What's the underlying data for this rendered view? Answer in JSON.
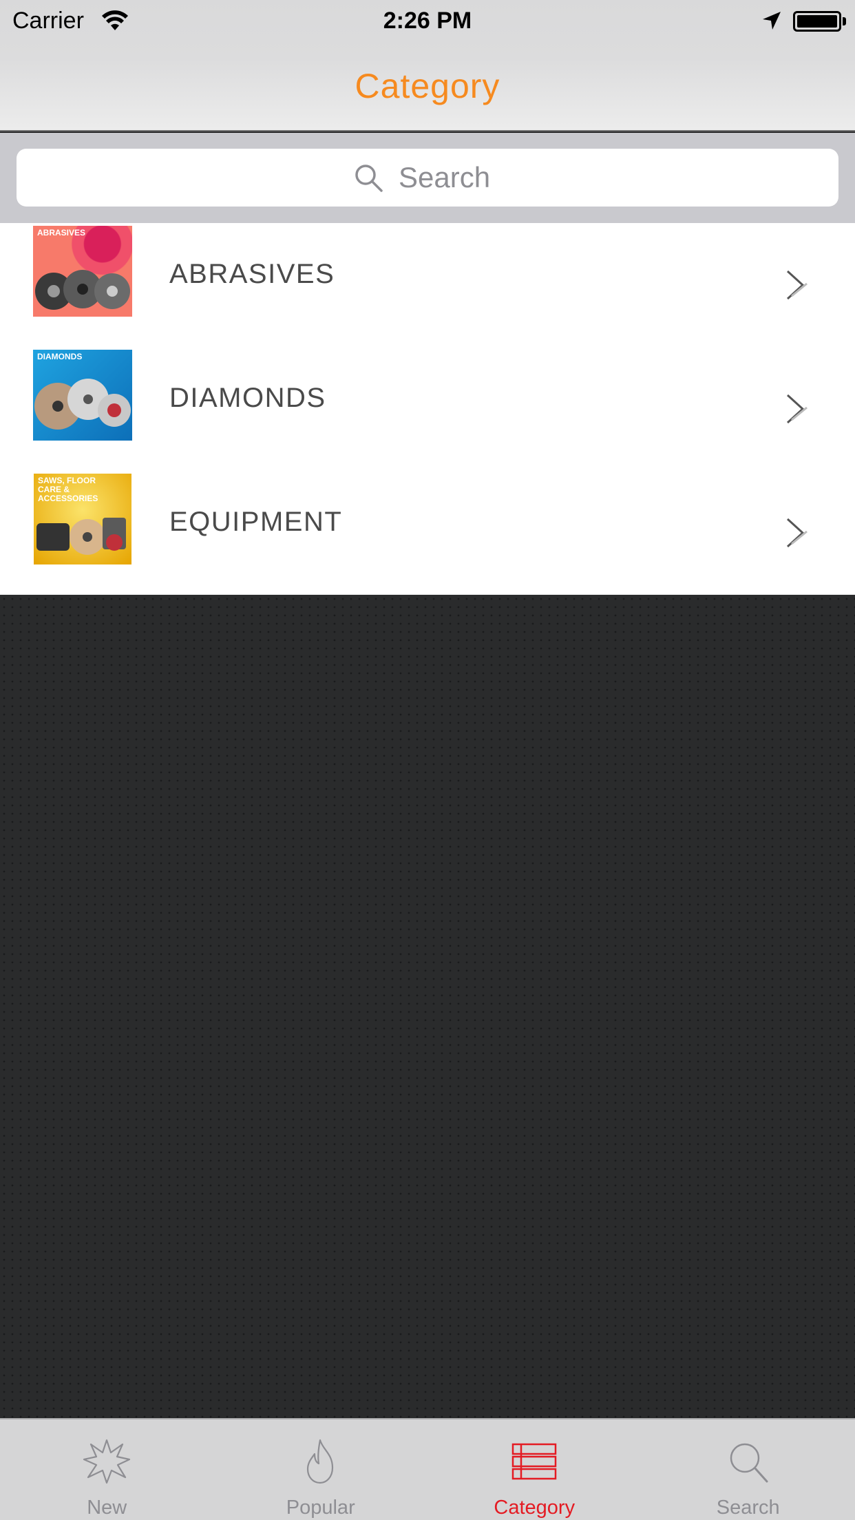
{
  "status_bar": {
    "carrier": "Carrier",
    "time": "2:26 PM"
  },
  "nav": {
    "title": "Category",
    "title_color": "#f68a1f"
  },
  "search": {
    "placeholder": "Search",
    "value": ""
  },
  "categories": [
    {
      "label": "ABRASIVES",
      "thumb_text": "ABRASIVES",
      "thumb_icon": "abrasive-discs-thumbnail",
      "thumb_color": "#e8394a"
    },
    {
      "label": "DIAMONDS",
      "thumb_text": "DIAMONDS",
      "thumb_icon": "diamond-blades-thumbnail",
      "thumb_color": "#1f8fd6"
    },
    {
      "label": "EQUIPMENT",
      "thumb_text": "SAWS, FLOOR CARE & ACCESSORIES",
      "thumb_icon": "equipment-thumbnail",
      "thumb_color": "#f3c21b"
    }
  ],
  "tabs": [
    {
      "label": "New",
      "icon": "star-burst-icon",
      "active": false
    },
    {
      "label": "Popular",
      "icon": "flame-icon",
      "active": false
    },
    {
      "label": "Category",
      "icon": "list-icon",
      "active": true
    },
    {
      "label": "Search",
      "icon": "magnifier-icon",
      "active": false
    }
  ],
  "colors": {
    "active_tab": "#e41b23",
    "inactive_tab": "#8e8e93",
    "background": "#262728"
  }
}
